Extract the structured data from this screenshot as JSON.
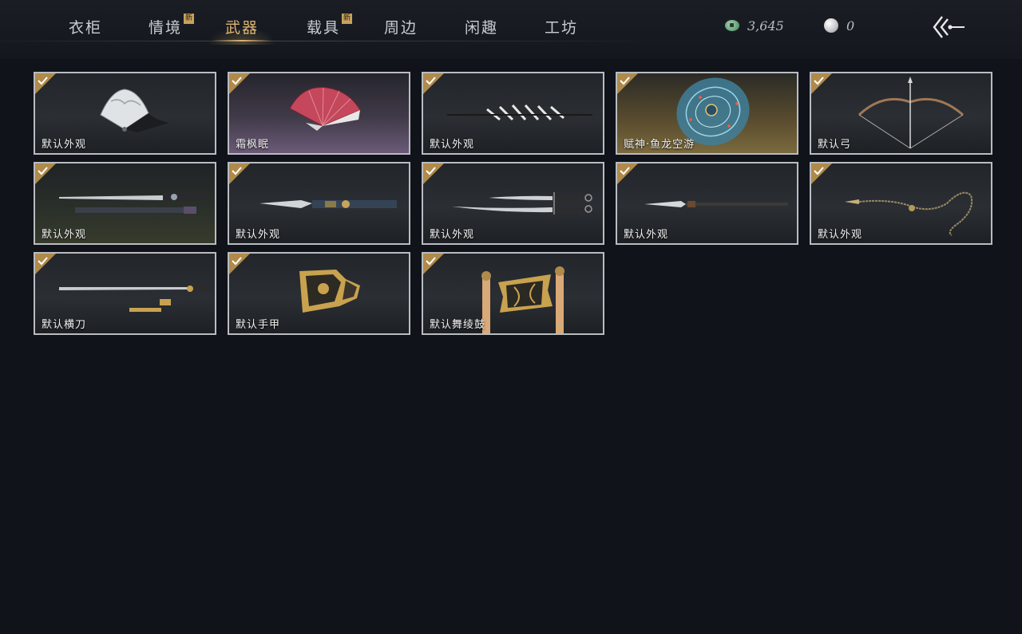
{
  "tabs": [
    {
      "label": "衣柜",
      "badge": "",
      "active": false
    },
    {
      "label": "情境",
      "badge": "新",
      "active": false
    },
    {
      "label": "武器",
      "badge": "",
      "active": true
    },
    {
      "label": "载具",
      "badge": "新",
      "active": false
    },
    {
      "label": "周边",
      "badge": "",
      "active": false
    },
    {
      "label": "闲趣",
      "badge": "",
      "active": false
    },
    {
      "label": "工坊",
      "badge": "",
      "active": false
    }
  ],
  "currency": {
    "jade_coin": "3,645",
    "pearl": "0"
  },
  "items": [
    {
      "name": "默认外观",
      "icon": "folding-fan-white-icon",
      "owned": true
    },
    {
      "name": "霜枫眠",
      "icon": "folding-fan-red-icon",
      "owned": true
    },
    {
      "name": "默认外观",
      "icon": "umbrella-icon",
      "owned": true
    },
    {
      "name": "赋神·鱼龙空游",
      "icon": "glowing-shield-icon",
      "owned": true
    },
    {
      "name": "默认弓",
      "icon": "bow-icon",
      "owned": true
    },
    {
      "name": "默认外观",
      "icon": "long-sword-icon",
      "owned": true
    },
    {
      "name": "默认外观",
      "icon": "blade-icon",
      "owned": true
    },
    {
      "name": "默认外观",
      "icon": "twin-sabres-icon",
      "owned": true
    },
    {
      "name": "默认外观",
      "icon": "spear-icon",
      "owned": true
    },
    {
      "name": "默认外观",
      "icon": "rope-dart-icon",
      "owned": true
    },
    {
      "name": "默认横刀",
      "icon": "hengdao-icon",
      "owned": true
    },
    {
      "name": "默认手甲",
      "icon": "gauntlet-icon",
      "owned": true
    },
    {
      "name": "默认舞绫鼓",
      "icon": "drum-icon",
      "owned": true
    }
  ]
}
